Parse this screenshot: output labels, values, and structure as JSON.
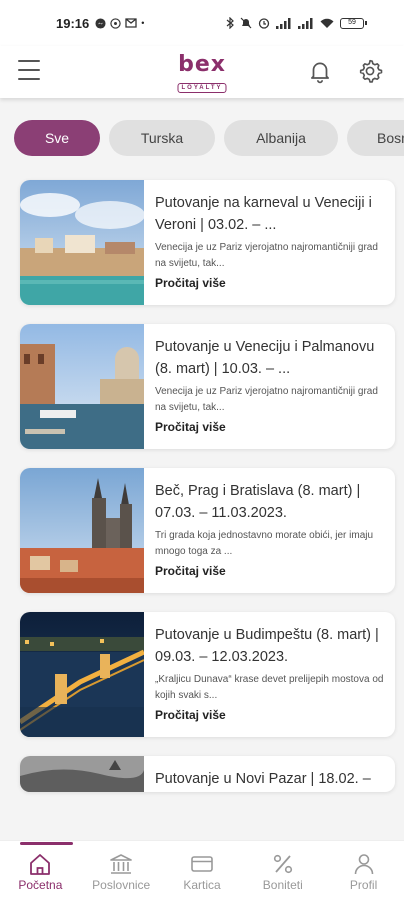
{
  "status_bar": {
    "time": "19:16",
    "left_icons": [
      "messenger-icon",
      "whatsapp-icon",
      "gmail-icon",
      "dot-icon"
    ],
    "right_icons": [
      "bluetooth-icon",
      "mute-icon",
      "alarm-icon",
      "signal-icon",
      "signal-icon",
      "wifi-icon"
    ],
    "battery": "59"
  },
  "header": {
    "logo_text": "bex",
    "logo_sub": "LOYALTY",
    "icons": [
      "menu-icon",
      "bell-icon",
      "gear-icon"
    ]
  },
  "colors": {
    "brand": "#8b2f6b",
    "chip_active": "#8b3f75",
    "chip_inactive": "#e0e0e0"
  },
  "chips": [
    {
      "label": "Sve",
      "active": true
    },
    {
      "label": "Turska",
      "active": false
    },
    {
      "label": "Albanija",
      "active": false
    },
    {
      "label": "Bosn",
      "active": false
    }
  ],
  "cards": [
    {
      "title": "Putovanje na karneval u Veneciji i Veroni | 03.02. – ...",
      "desc": "Venecija je uz Pariz vjerojatno najromantičniji grad na svijetu, tak...",
      "more": "Pročitaj više",
      "image": "venice-canal-photo"
    },
    {
      "title": "Putovanje u Veneciju i Palmanovu (8. mart) | 10.03. – ...",
      "desc": "Venecija je uz Pariz vjerojatno najromantičniji grad na svijetu, tak...",
      "more": "Pročitaj više",
      "image": "venice-grand-canal-photo"
    },
    {
      "title": "Beč, Prag i Bratislava (8. mart) | 07.03. – 11.03.2023.",
      "desc": "Tri grada koja jednostavno morate obići, jer imaju mnogo toga za ...",
      "more": "Pročitaj više",
      "image": "prague-church-photo"
    },
    {
      "title": "Putovanje u Budimpeštu (8. mart) | 09.03. – 12.03.2023.",
      "desc": "„Kraljicu Dunava“ krase devet prelijepih mostova od kojih svaki s...",
      "more": "Pročitaj više",
      "image": "budapest-bridge-photo"
    },
    {
      "title": "Putovanje u Novi Pazar | 18.02. –",
      "image": "novi-pazar-photo"
    }
  ],
  "bottom_nav": [
    {
      "label": "Početna",
      "icon": "home-icon",
      "active": true
    },
    {
      "label": "Poslovnice",
      "icon": "bank-icon",
      "active": false
    },
    {
      "label": "Kartica",
      "icon": "card-icon",
      "active": false
    },
    {
      "label": "Boniteti",
      "icon": "percent-icon",
      "active": false
    },
    {
      "label": "Profil",
      "icon": "user-icon",
      "active": false
    }
  ]
}
